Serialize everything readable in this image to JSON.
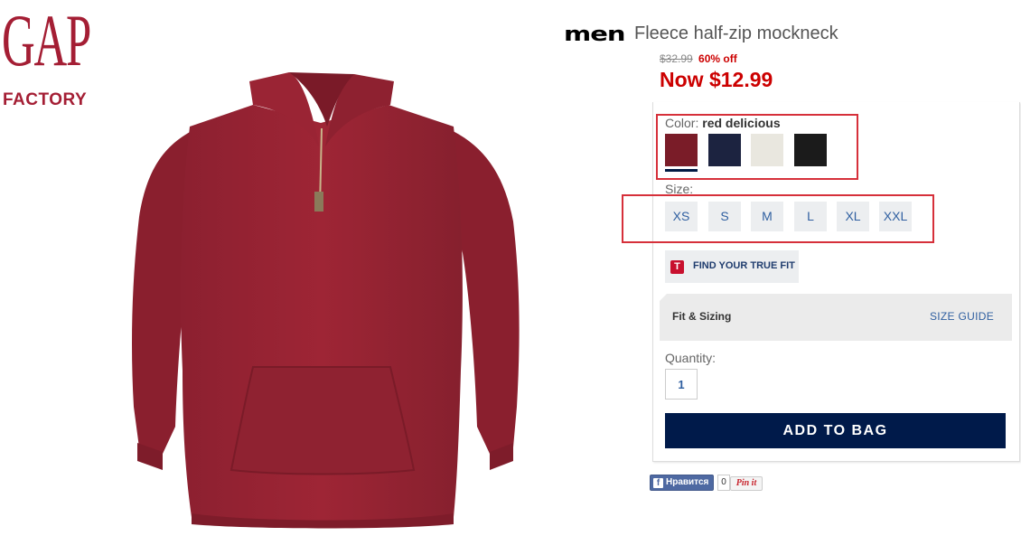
{
  "logo": {
    "brand": "GAP",
    "subbrand": "FACTORY"
  },
  "product": {
    "department": "men",
    "name": "Fleece half-zip mockneck",
    "original_price": "$32.99",
    "discount": "60% off",
    "now_price": "Now $12.99"
  },
  "color": {
    "label": "Color:",
    "selected": "red delicious",
    "swatches": [
      {
        "name": "red delicious",
        "hex": "#7a1c28",
        "selected": true
      },
      {
        "name": "navy",
        "hex": "#1c2340",
        "selected": false
      },
      {
        "name": "cream",
        "hex": "#e9e7df",
        "selected": false
      },
      {
        "name": "black",
        "hex": "#1b1b1b",
        "selected": false
      }
    ]
  },
  "size": {
    "label": "Size:",
    "options": [
      "XS",
      "S",
      "M",
      "L",
      "XL",
      "XXL"
    ]
  },
  "truefit": {
    "icon": "T",
    "label": "FIND YOUR TRUE FIT"
  },
  "fit": {
    "title": "Fit & Sizing",
    "size_guide": "SIZE GUIDE"
  },
  "quantity": {
    "label": "Quantity:",
    "value": "1"
  },
  "add_to_bag": "ADD TO BAG",
  "social": {
    "facebook_like": "Нравится",
    "facebook_count": "0",
    "pinterest": "Pin it"
  },
  "colors": {
    "accent_red": "#cc0000",
    "brand_red": "#a41e34",
    "navy_button": "#001a4a",
    "link_blue": "#2f5fa0",
    "highlight_red": "#d6303a"
  }
}
